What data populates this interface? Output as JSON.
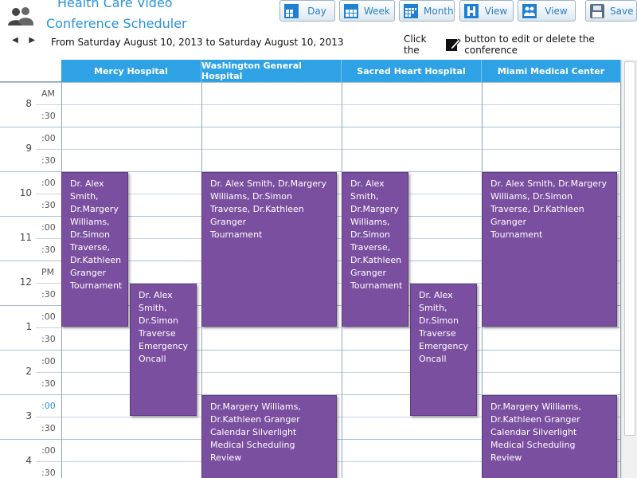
{
  "app": {
    "icon": "users-icon",
    "title_line1": "Health Care Video",
    "title_line2": "Conference Scheduler"
  },
  "toolbar": [
    {
      "label": "Day",
      "icon": "day-grid-icon"
    },
    {
      "label": "Week",
      "icon": "week-grid-icon"
    },
    {
      "label": "Month",
      "icon": "month-grid-icon"
    },
    {
      "label": "View",
      "icon": "hospital-icon"
    },
    {
      "label": "View",
      "icon": "people-icon"
    },
    {
      "label": "Save",
      "icon": "save-icon"
    }
  ],
  "nav": {
    "prev": "◀",
    "next": "▶"
  },
  "date_range": "From Saturday August 10, 2013 to Saturday August 10, 2013",
  "hint": {
    "before": "Click the",
    "after": "button to edit or delete the conference",
    "icon": "pencil-icon"
  },
  "columns": [
    "Mercy Hospital",
    "Washington General Hospital",
    "Sacred Heart Hospital",
    "Miami Medical Center"
  ],
  "times": [
    {
      "hour": "8",
      "top": "AM",
      "bottom": ":30"
    },
    {
      "hour": "9",
      "top": ":00",
      "bottom": ":30"
    },
    {
      "hour": "10",
      "top": ":00",
      "bottom": ":30"
    },
    {
      "hour": "11",
      "top": ":00",
      "bottom": ":30"
    },
    {
      "hour": "12",
      "top": "PM",
      "bottom": ":30"
    },
    {
      "hour": "1",
      "top": ":00",
      "bottom": ":30"
    },
    {
      "hour": "2",
      "top": ":00",
      "bottom": ":30"
    },
    {
      "hour": "3",
      "top": ":00",
      "bottom": ":30"
    },
    {
      "hour": "4",
      "top": ":00",
      "bottom": ":30"
    }
  ],
  "events": [
    {
      "column": 0,
      "lane": 0,
      "start": "10:00",
      "end": "1:30",
      "who": "Dr. Alex Smith, Dr.Margery Williams, Dr.Simon Traverse, Dr.Kathleen Granger",
      "what": "Tournament"
    },
    {
      "column": 0,
      "lane": 1,
      "start": "12:30",
      "end": "3:30",
      "who": "Dr. Alex Smith, Dr.Simon Traverse",
      "what": "Emergency Oncall"
    },
    {
      "column": 1,
      "lane": 0,
      "start": "10:00",
      "end": "1:30",
      "who": "Dr. Alex Smith, Dr.Margery Williams, Dr.Simon Traverse, Dr.Kathleen Granger",
      "what": "Tournament"
    },
    {
      "column": 1,
      "lane": 0,
      "start": "3:00",
      "end": "5:00",
      "who": "Dr.Margery Williams, Dr.Kathleen Granger",
      "what": "Calendar Silverlight Medical Scheduling Review"
    },
    {
      "column": 2,
      "lane": 0,
      "start": "10:00",
      "end": "1:30",
      "who": "Dr. Alex Smith, Dr.Margery Williams, Dr.Simon Traverse, Dr.Kathleen Granger",
      "what": "Tournament"
    },
    {
      "column": 2,
      "lane": 1,
      "start": "12:30",
      "end": "3:30",
      "who": "Dr. Alex Smith, Dr.Simon Traverse",
      "what": "Emergency Oncall"
    },
    {
      "column": 3,
      "lane": 0,
      "start": "10:00",
      "end": "1:30",
      "who": "Dr. Alex Smith, Dr.Margery Williams, Dr.Simon Traverse, Dr.Kathleen Granger",
      "what": "Tournament"
    },
    {
      "column": 3,
      "lane": 0,
      "start": "3:00",
      "end": "5:00",
      "who": "Dr.Margery Williams, Dr.Kathleen Granger",
      "what": "Calendar Silverlight Medical Scheduling Review"
    }
  ],
  "colors": {
    "header": "#2ea2e4",
    "event": "#7a4fa0",
    "title": "#2a92d6"
  }
}
